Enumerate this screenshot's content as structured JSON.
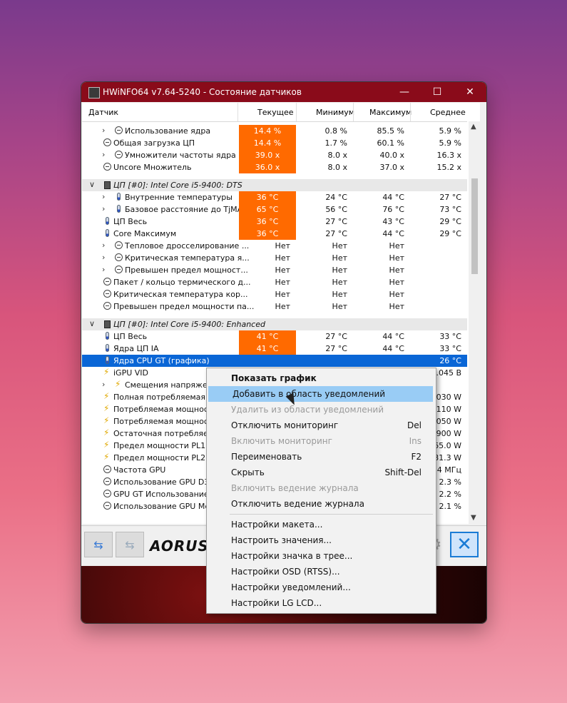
{
  "window": {
    "title": "HWiNFO64 v7.64-5240 - Состояние датчиков",
    "controls": [
      "—",
      "☐",
      "✕"
    ]
  },
  "table": {
    "headers": [
      "Датчик",
      "Текущее",
      "Минимум",
      "Максимум",
      "Среднее"
    ],
    "rows": [
      {
        "name": "Использование ядра",
        "icon": "gauge-icon",
        "expand": true,
        "cur": "14.4 %",
        "min": "0.8 %",
        "max": "85.5 %",
        "avg": "5.9 %",
        "hot": true
      },
      {
        "name": "Общая загрузка ЦП",
        "icon": "gauge-icon",
        "expand": false,
        "cur": "14.4 %",
        "min": "1.7 %",
        "max": "60.1 %",
        "avg": "5.9 %",
        "hot": true
      },
      {
        "name": "Умножители частоты ядра",
        "icon": "gauge-icon",
        "expand": true,
        "cur": "39.0 x",
        "min": "8.0 x",
        "max": "40.0 x",
        "avg": "16.3 x",
        "hot": true
      },
      {
        "name": "Uncore Множитель",
        "icon": "gauge-icon",
        "expand": false,
        "cur": "36.0 x",
        "min": "8.0 x",
        "max": "37.0 x",
        "avg": "15.2 x",
        "hot": true
      },
      {
        "group": true,
        "name": "ЦП [#0]: Intel Core i5-9400: DTS"
      },
      {
        "name": "Внутренние температуры",
        "icon": "thermometer-icon",
        "expand": true,
        "cur": "36 °C",
        "min": "24 °C",
        "max": "44 °C",
        "avg": "27 °C",
        "hot": true
      },
      {
        "name": "Базовое расстояние до TjMAX",
        "icon": "thermometer-icon",
        "expand": true,
        "cur": "65 °C",
        "min": "56 °C",
        "max": "76 °C",
        "avg": "73 °C",
        "hot": true
      },
      {
        "name": "ЦП Весь",
        "icon": "thermometer-icon",
        "expand": false,
        "cur": "36 °C",
        "min": "27 °C",
        "max": "43 °C",
        "avg": "29 °C",
        "hot": true
      },
      {
        "name": "Core Максимум",
        "icon": "thermometer-icon",
        "expand": false,
        "cur": "36 °C",
        "min": "27 °C",
        "max": "44 °C",
        "avg": "29 °C",
        "hot": true
      },
      {
        "name": "Тепловое дросселирование ...",
        "icon": "gauge-icon",
        "expand": true,
        "cur": "Нет",
        "min": "Нет",
        "max": "Нет",
        "avg": "",
        "hot": false
      },
      {
        "name": "Критическая температура я...",
        "icon": "gauge-icon",
        "expand": true,
        "cur": "Нет",
        "min": "Нет",
        "max": "Нет",
        "avg": "",
        "hot": false
      },
      {
        "name": "Превышен предел мощност...",
        "icon": "gauge-icon",
        "expand": true,
        "cur": "Нет",
        "min": "Нет",
        "max": "Нет",
        "avg": "",
        "hot": false
      },
      {
        "name": "Пакет / кольцо термического д...",
        "icon": "gauge-icon",
        "expand": false,
        "cur": "Нет",
        "min": "Нет",
        "max": "Нет",
        "avg": "",
        "hot": false
      },
      {
        "name": "Критическая температура кор...",
        "icon": "gauge-icon",
        "expand": false,
        "cur": "Нет",
        "min": "Нет",
        "max": "Нет",
        "avg": "",
        "hot": false
      },
      {
        "name": "Превышен предел мощности па...",
        "icon": "gauge-icon",
        "expand": false,
        "cur": "Нет",
        "min": "Нет",
        "max": "Нет",
        "avg": "",
        "hot": false
      },
      {
        "group": true,
        "name": "ЦП [#0]: Intel Core i5-9400: Enhanced"
      },
      {
        "name": "ЦП Весь",
        "icon": "thermometer-icon",
        "expand": false,
        "cur": "41 °C",
        "min": "27 °C",
        "max": "44 °C",
        "avg": "33 °C",
        "hot": true
      },
      {
        "name": "Ядра ЦП IA",
        "icon": "thermometer-icon",
        "expand": false,
        "cur": "41 °C",
        "min": "27 °C",
        "max": "44 °C",
        "avg": "33 °C",
        "hot": true
      },
      {
        "name": "Ядра CPU GT (графика)",
        "icon": "thermometer-icon",
        "expand": false,
        "cur": "",
        "min": "",
        "max": "",
        "avg": "26 °C",
        "hot": false,
        "selected": true
      },
      {
        "name": "iGPU VID",
        "icon": "bolt-icon",
        "expand": false,
        "cur": "",
        "min": "",
        "max": "",
        "avg": "0.045 В",
        "hot": false
      },
      {
        "name": "Смещения напряжения",
        "icon": "bolt-icon",
        "expand": true,
        "cur": "",
        "min": "",
        "max": "",
        "avg": "",
        "hot": false
      },
      {
        "name": "Полная потребляемая мощ",
        "icon": "bolt-icon",
        "expand": false,
        "cur": "",
        "min": "",
        "max": "",
        "avg": "4.030 W",
        "hot": false
      },
      {
        "name": "Потребляемая мощность я",
        "icon": "bolt-icon",
        "expand": false,
        "cur": "",
        "min": "",
        "max": "",
        "avg": "3.110 W",
        "hot": false
      },
      {
        "name": "Потребляемая мощность",
        "icon": "bolt-icon",
        "expand": false,
        "cur": "",
        "min": "",
        "max": "",
        "avg": "0.050 W",
        "hot": false
      },
      {
        "name": "Остаточная потребляема",
        "icon": "bolt-icon",
        "expand": false,
        "cur": "",
        "min": "",
        "max": "",
        "avg": "0.900 W",
        "hot": false
      },
      {
        "name": "Предел мощности PL1 (Sta",
        "icon": "bolt-icon",
        "expand": false,
        "cur": "",
        "min": "",
        "max": "",
        "avg": "65.0 W",
        "hot": false
      },
      {
        "name": "Предел мощности PL2 (Sta",
        "icon": "bolt-icon",
        "expand": false,
        "cur": "",
        "min": "",
        "max": "",
        "avg": "81.3 W",
        "hot": false
      },
      {
        "name": "Частота GPU",
        "icon": "gauge-icon",
        "expand": false,
        "cur": "",
        "min": "",
        "max": "",
        "avg": "4.4 МГц",
        "hot": false
      },
      {
        "name": "Использование GPU D3D",
        "icon": "gauge-icon",
        "expand": false,
        "cur": "",
        "min": "",
        "max": "",
        "avg": "2.3 %",
        "hot": false
      },
      {
        "name": "GPU GT Использование",
        "icon": "gauge-icon",
        "expand": false,
        "cur": "",
        "min": "",
        "max": "",
        "avg": "2.2 %",
        "hot": false
      },
      {
        "name": "Использование GPU Media",
        "icon": "gauge-icon",
        "expand": false,
        "cur": "",
        "min": "",
        "max": "",
        "avg": "2.1 %",
        "hot": false
      }
    ]
  },
  "toolbar": {
    "brand": "AORUS"
  },
  "context_menu": {
    "items": [
      {
        "label": "Показать график",
        "key": "",
        "disabled": false,
        "bold": true
      },
      {
        "label": "Добавить в область уведомлений",
        "key": "",
        "disabled": false,
        "highlight": true
      },
      {
        "label": "Удалить из области уведомлений",
        "key": "",
        "disabled": true
      },
      {
        "label": "Отключить мониторинг",
        "key": "Del",
        "disabled": false
      },
      {
        "label": "Включить мониторинг",
        "key": "Ins",
        "disabled": true
      },
      {
        "label": "Переименовать",
        "key": "F2",
        "disabled": false
      },
      {
        "label": "Скрыть",
        "key": "Shift-Del",
        "disabled": false
      },
      {
        "label": "Включить ведение журнала",
        "key": "",
        "disabled": true
      },
      {
        "label": "Отключить ведение журнала",
        "key": "",
        "disabled": false
      },
      {
        "separator": true
      },
      {
        "label": "Настройки макета...",
        "key": "",
        "disabled": false
      },
      {
        "label": "Настроить значения...",
        "key": "",
        "disabled": false
      },
      {
        "label": "Настройки значка в трее...",
        "key": "",
        "disabled": false
      },
      {
        "label": "Настройки OSD (RTSS)...",
        "key": "",
        "disabled": false
      },
      {
        "label": "Настройки уведомлений...",
        "key": "",
        "disabled": false
      },
      {
        "label": "Настройки LG LCD...",
        "key": "",
        "disabled": false
      }
    ]
  },
  "colors": {
    "accent_hot": "#ff6a00",
    "selection": "#0a66d6",
    "titlebar": "#8a0b1a",
    "menu_highlight": "#99ccf5"
  }
}
